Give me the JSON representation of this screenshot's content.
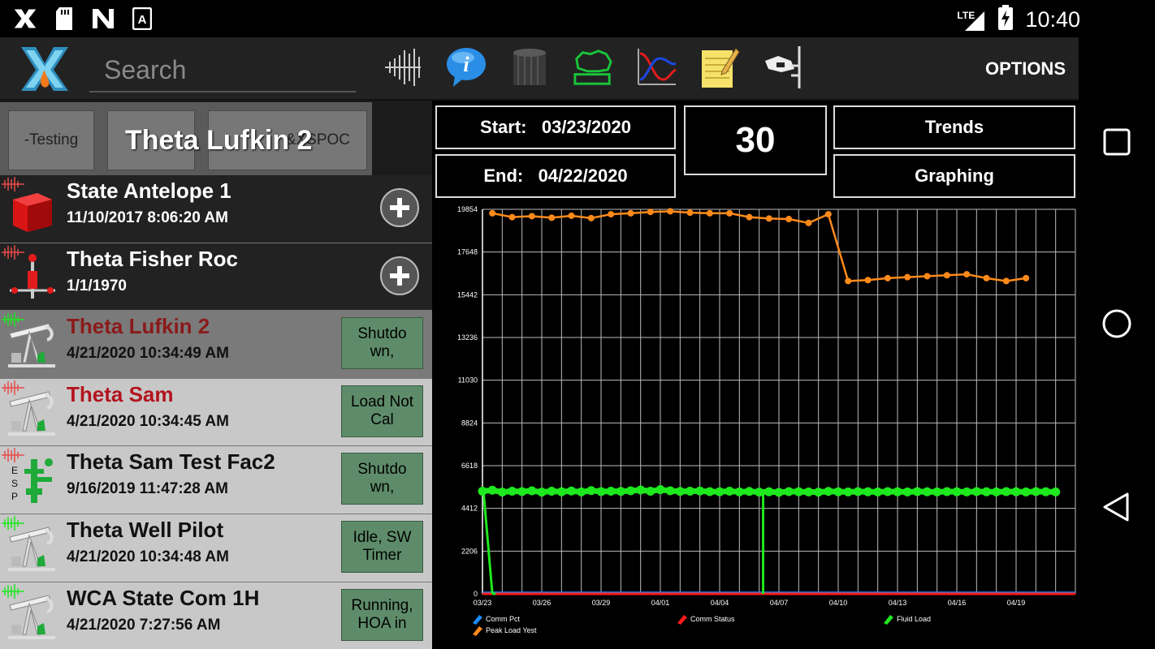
{
  "status_bar": {
    "time": "10:40",
    "network": "LTE",
    "left_icons": [
      "x-app-icon",
      "sd-card-icon",
      "n-app-icon",
      "a-app-icon"
    ]
  },
  "app_bar": {
    "search_placeholder": "Search",
    "options_label": "OPTIONS",
    "toolbar_icons": [
      "waveform-icon",
      "info-icon",
      "tank-icon",
      "map-icon",
      "trend-graph-icon",
      "notepad-icon",
      "valve-icon"
    ]
  },
  "group_tabs": {
    "left_chip": "-Testing",
    "right_chip": "&XSPOC",
    "title": "Theta Lufkin 2"
  },
  "wells": [
    {
      "name": "State Antelope 1",
      "date": "11/10/2017 8:06:20 AM",
      "style": "dark",
      "icon": "cube-icon",
      "action": "plus",
      "alarm": false
    },
    {
      "name": "Theta Fisher Roc",
      "date": "1/1/1970",
      "style": "dark",
      "icon": "wellhead-icon",
      "action": "plus",
      "alarm": false
    },
    {
      "name": "Theta Lufkin 2",
      "date": "4/21/2020 10:34:49 AM",
      "style": "selected",
      "icon": "pumpjack-icon",
      "action": "Shutdo wn,",
      "alarm": true
    },
    {
      "name": "Theta Sam",
      "date": "4/21/2020 10:34:45 AM",
      "style": "light",
      "icon": "pumpjack-icon",
      "action": "Load Not Cal",
      "alarm": true
    },
    {
      "name": "Theta Sam Test Fac2",
      "date": "9/16/2019 11:47:28 AM",
      "style": "light",
      "icon": "esp-icon",
      "action": "Shutdo wn,",
      "alarm": false
    },
    {
      "name": "Theta Well Pilot",
      "date": "4/21/2020 10:34:48 AM",
      "style": "light",
      "icon": "pumpjack-icon",
      "action": "Idle, SW Timer",
      "alarm": false
    },
    {
      "name": "WCA State Com 1H",
      "date": "4/21/2020 7:27:56 AM",
      "style": "light",
      "icon": "pumpjack-icon",
      "action": "Running, HOA in",
      "alarm": false
    }
  ],
  "date_controls": {
    "start_label": "Start:",
    "start_value": "03/23/2020",
    "end_label": "End:",
    "end_value": "04/22/2020",
    "days": "30",
    "trends_label": "Trends",
    "graphing_label": "Graphing"
  },
  "colors": {
    "fluid_load": "#1ee81e",
    "peak_load": "#ff8a1a",
    "comm_status": "#ff1a1a",
    "comm_pct": "#1a8cff",
    "status_green": "#5e8c6a"
  },
  "chart_data": {
    "type": "line",
    "y_ticks": [
      "0",
      "2206",
      "4412",
      "6618",
      "8824",
      "11030",
      "13236",
      "15442",
      "17648",
      "19854"
    ],
    "ylim": [
      0,
      19854
    ],
    "x_ticks": [
      "03/23",
      "03/26",
      "03/29",
      "04/01",
      "04/04",
      "04/07",
      "04/10",
      "04/13",
      "04/16",
      "04/19"
    ],
    "xlim": [
      0,
      30
    ],
    "grid": true,
    "legend": [
      {
        "name": "Comm Pct",
        "color": "#1a8cff"
      },
      {
        "name": "Peak Load Yest",
        "color": "#ff8a1a"
      },
      {
        "name": "Comm Status",
        "color": "#ff1a1a"
      },
      {
        "name": "Fluid Load",
        "color": "#1ee81e"
      }
    ],
    "series": [
      {
        "name": "Peak Load Yest",
        "x": [
          0.5,
          1.5,
          2.5,
          3.5,
          4.5,
          5.5,
          6.5,
          7.5,
          8.5,
          9.5,
          10.5,
          11.5,
          12.5,
          13.5,
          14.5,
          15.5,
          16.5,
          17.5,
          18.5,
          19.5,
          20.5,
          21.5,
          22.5,
          23.5,
          24.5,
          25.5,
          26.5,
          27.5
        ],
        "values": [
          19650,
          19450,
          19500,
          19420,
          19520,
          19400,
          19600,
          19650,
          19720,
          19750,
          19680,
          19650,
          19650,
          19450,
          19380,
          19350,
          19150,
          19600,
          16150,
          16200,
          16300,
          16350,
          16400,
          16450,
          16500,
          16300,
          16150,
          16300
        ]
      },
      {
        "name": "Fluid Load",
        "x": [
          0,
          0.5,
          1,
          1.5,
          2,
          2.5,
          3,
          3.5,
          4,
          4.5,
          5,
          5.5,
          6,
          6.5,
          7,
          7.5,
          8,
          8.5,
          9,
          9.5,
          10,
          10.5,
          11,
          11.5,
          12,
          12.5,
          13,
          13.5,
          14,
          14.5,
          15,
          15.5,
          16,
          16.5,
          17,
          17.5,
          18,
          18.5,
          19,
          19.5,
          20,
          20.5,
          21,
          21.5,
          22,
          22.5,
          23,
          23.5,
          24,
          24.5,
          25,
          25.5,
          26,
          26.5,
          27,
          27.5,
          28,
          28.5,
          29
        ],
        "values": [
          5300,
          5350,
          5250,
          5300,
          5280,
          5320,
          5250,
          5300,
          5270,
          5310,
          5260,
          5330,
          5280,
          5300,
          5290,
          5320,
          5360,
          5300,
          5380,
          5320,
          5290,
          5300,
          5310,
          5280,
          5270,
          5300,
          5260,
          5290,
          5250,
          5270,
          5240,
          5280,
          5270,
          5260,
          5250,
          5290,
          5270,
          5260,
          5280,
          5270,
          5260,
          5280,
          5270,
          5260,
          5280,
          5270,
          5260,
          5280,
          5270,
          5260,
          5280,
          5270,
          5260,
          5280,
          5270,
          5260,
          5280,
          5270,
          5260
        ]
      },
      {
        "name": "Comm Status",
        "x": [
          0,
          30
        ],
        "values": [
          0,
          0
        ]
      },
      {
        "name": "Comm Pct",
        "x": [
          0,
          30
        ],
        "values": [
          50,
          50
        ]
      }
    ],
    "fluid_drops": [
      {
        "x_from": 0.05,
        "x_to": 0.5
      },
      {
        "x_at": 14.2
      }
    ]
  }
}
